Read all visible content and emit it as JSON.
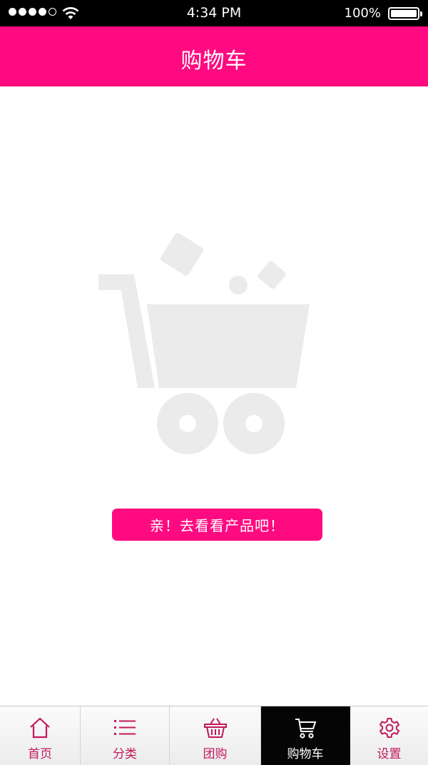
{
  "status_bar": {
    "time": "4:34 PM",
    "battery_percent": "100%",
    "signal_bars_filled": 4,
    "signal_bars_total": 5
  },
  "header": {
    "title": "购物车"
  },
  "empty_state": {
    "illustration_icon": "empty-shopping-cart",
    "illustration_color": "#ebebeb",
    "button_label": "亲！去看看产品吧！"
  },
  "tab_bar": {
    "tabs": [
      {
        "label": "首页",
        "icon": "home-icon"
      },
      {
        "label": "分类",
        "icon": "list-icon"
      },
      {
        "label": "团购",
        "icon": "basket-icon"
      },
      {
        "label": "购物车",
        "icon": "cart-icon",
        "active": true
      },
      {
        "label": "设置",
        "icon": "gear-icon"
      }
    ]
  },
  "colors": {
    "brand_pink": "#ff0a80",
    "tab_icon_color": "#c2185b",
    "active_tab_background": "#050505"
  }
}
